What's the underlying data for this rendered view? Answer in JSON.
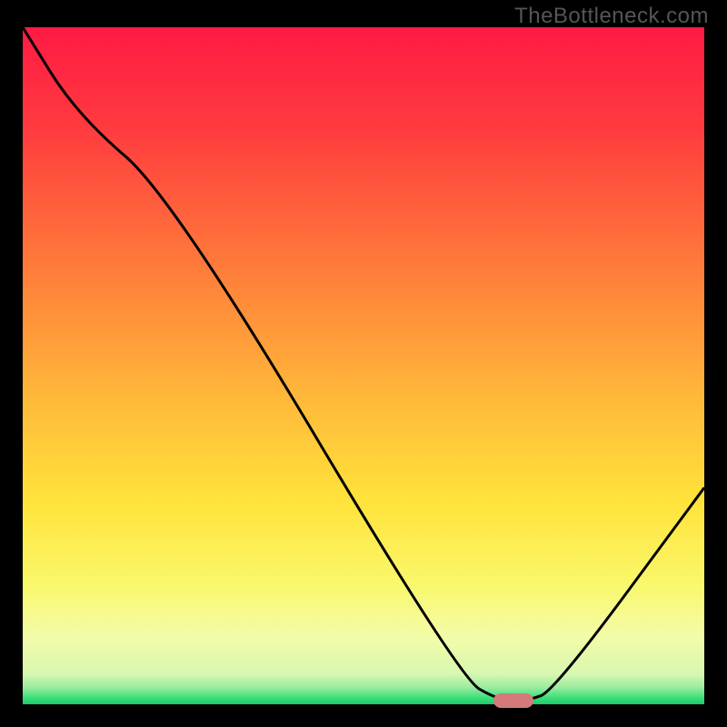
{
  "watermark": "TheBottleneck.com",
  "chart_data": {
    "type": "line",
    "title": "",
    "xlabel": "",
    "ylabel": "",
    "xlim": [
      0,
      100
    ],
    "ylim": [
      0,
      100
    ],
    "background_gradient": {
      "stops": [
        {
          "pos": 0.0,
          "color": "#ff1a44"
        },
        {
          "pos": 0.15,
          "color": "#ff3b3f"
        },
        {
          "pos": 0.35,
          "color": "#ff7a3a"
        },
        {
          "pos": 0.55,
          "color": "#ffb93a"
        },
        {
          "pos": 0.7,
          "color": "#ffe33a"
        },
        {
          "pos": 0.82,
          "color": "#faf76a"
        },
        {
          "pos": 0.9,
          "color": "#f3fca8"
        },
        {
          "pos": 0.955,
          "color": "#d8f7b0"
        },
        {
          "pos": 0.975,
          "color": "#9beca0"
        },
        {
          "pos": 0.99,
          "color": "#3fe07a"
        },
        {
          "pos": 1.0,
          "color": "#1cc96b"
        }
      ]
    },
    "series": [
      {
        "name": "bottleneck-curve",
        "color": "#000000",
        "x": [
          0,
          8,
          22,
          64,
          70,
          74,
          78,
          100
        ],
        "y": [
          100,
          87,
          75,
          4,
          0.5,
          0.5,
          2,
          32
        ]
      }
    ],
    "marker": {
      "name": "optimal-point",
      "x_center": 72,
      "y": 0.5,
      "color": "#d47a7a"
    }
  }
}
